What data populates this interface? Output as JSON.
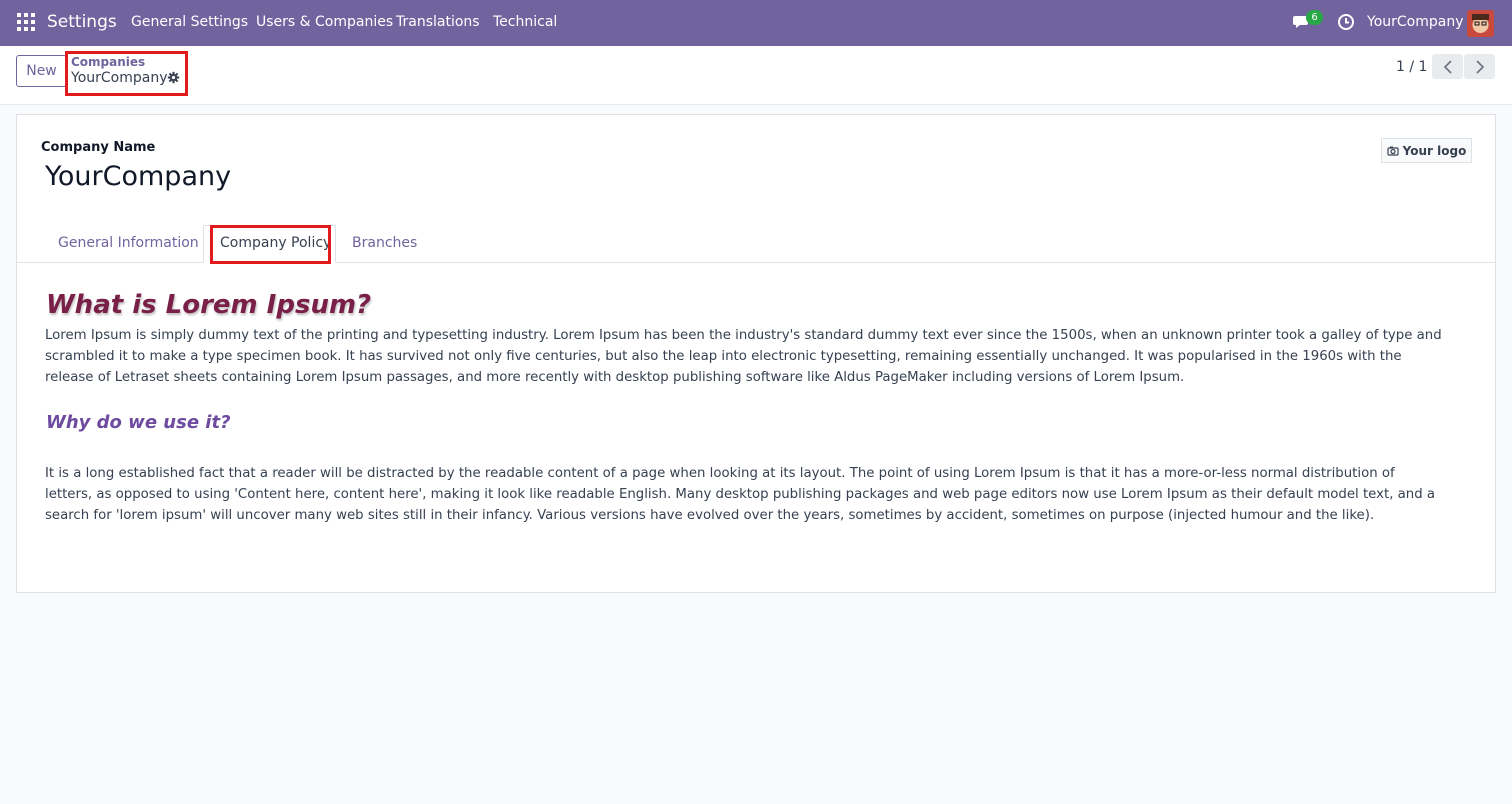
{
  "navbar": {
    "brand": "Settings",
    "menu": [
      "General Settings",
      "Users & Companies",
      "Translations",
      "Technical"
    ],
    "chat_count": "6",
    "company": "YourCompany"
  },
  "control_panel": {
    "new_label": "New",
    "breadcrumb_parent": "Companies",
    "breadcrumb_current": "YourCompany",
    "pager": "1 / 1"
  },
  "form": {
    "company_name_label": "Company Name",
    "company_name": "YourCompany",
    "logo_label": "Your logo",
    "tabs": [
      "General Information",
      "Company Policy",
      "Branches"
    ],
    "active_tab": "Company Policy",
    "heading1": "What is Lorem Ipsum?",
    "para1": "Lorem Ipsum is simply dummy text of the printing and typesetting industry. Lorem Ipsum has been the industry's standard dummy text ever since the 1500s, when an unknown printer took a galley of type and scrambled it to make a type specimen book. It has survived not only five centuries, but also the leap into electronic typesetting, remaining essentially unchanged. It was popularised in the 1960s with the release of Letraset sheets containing Lorem Ipsum passages, and more recently with desktop publishing software like Aldus PageMaker including versions of Lorem Ipsum.",
    "heading2": "Why do we use it?",
    "para2": "It is a long established fact that a reader will be distracted by the readable content of a page when looking at its layout. The point of using Lorem Ipsum is that it has a more-or-less normal distribution of letters, as opposed to using 'Content here, content here', making it look like readable English. Many desktop publishing packages and web page editors now use Lorem Ipsum as their default model text, and a search for 'lorem ipsum' will uncover many web sites still in their infancy. Various versions have evolved over the years, sometimes by accident, sometimes on purpose (injected humour and the like)."
  },
  "colors": {
    "navbar": "#71639e",
    "highlight": "#e11b1b",
    "heading1": "#7a2048",
    "heading2": "#6f4ba0"
  }
}
